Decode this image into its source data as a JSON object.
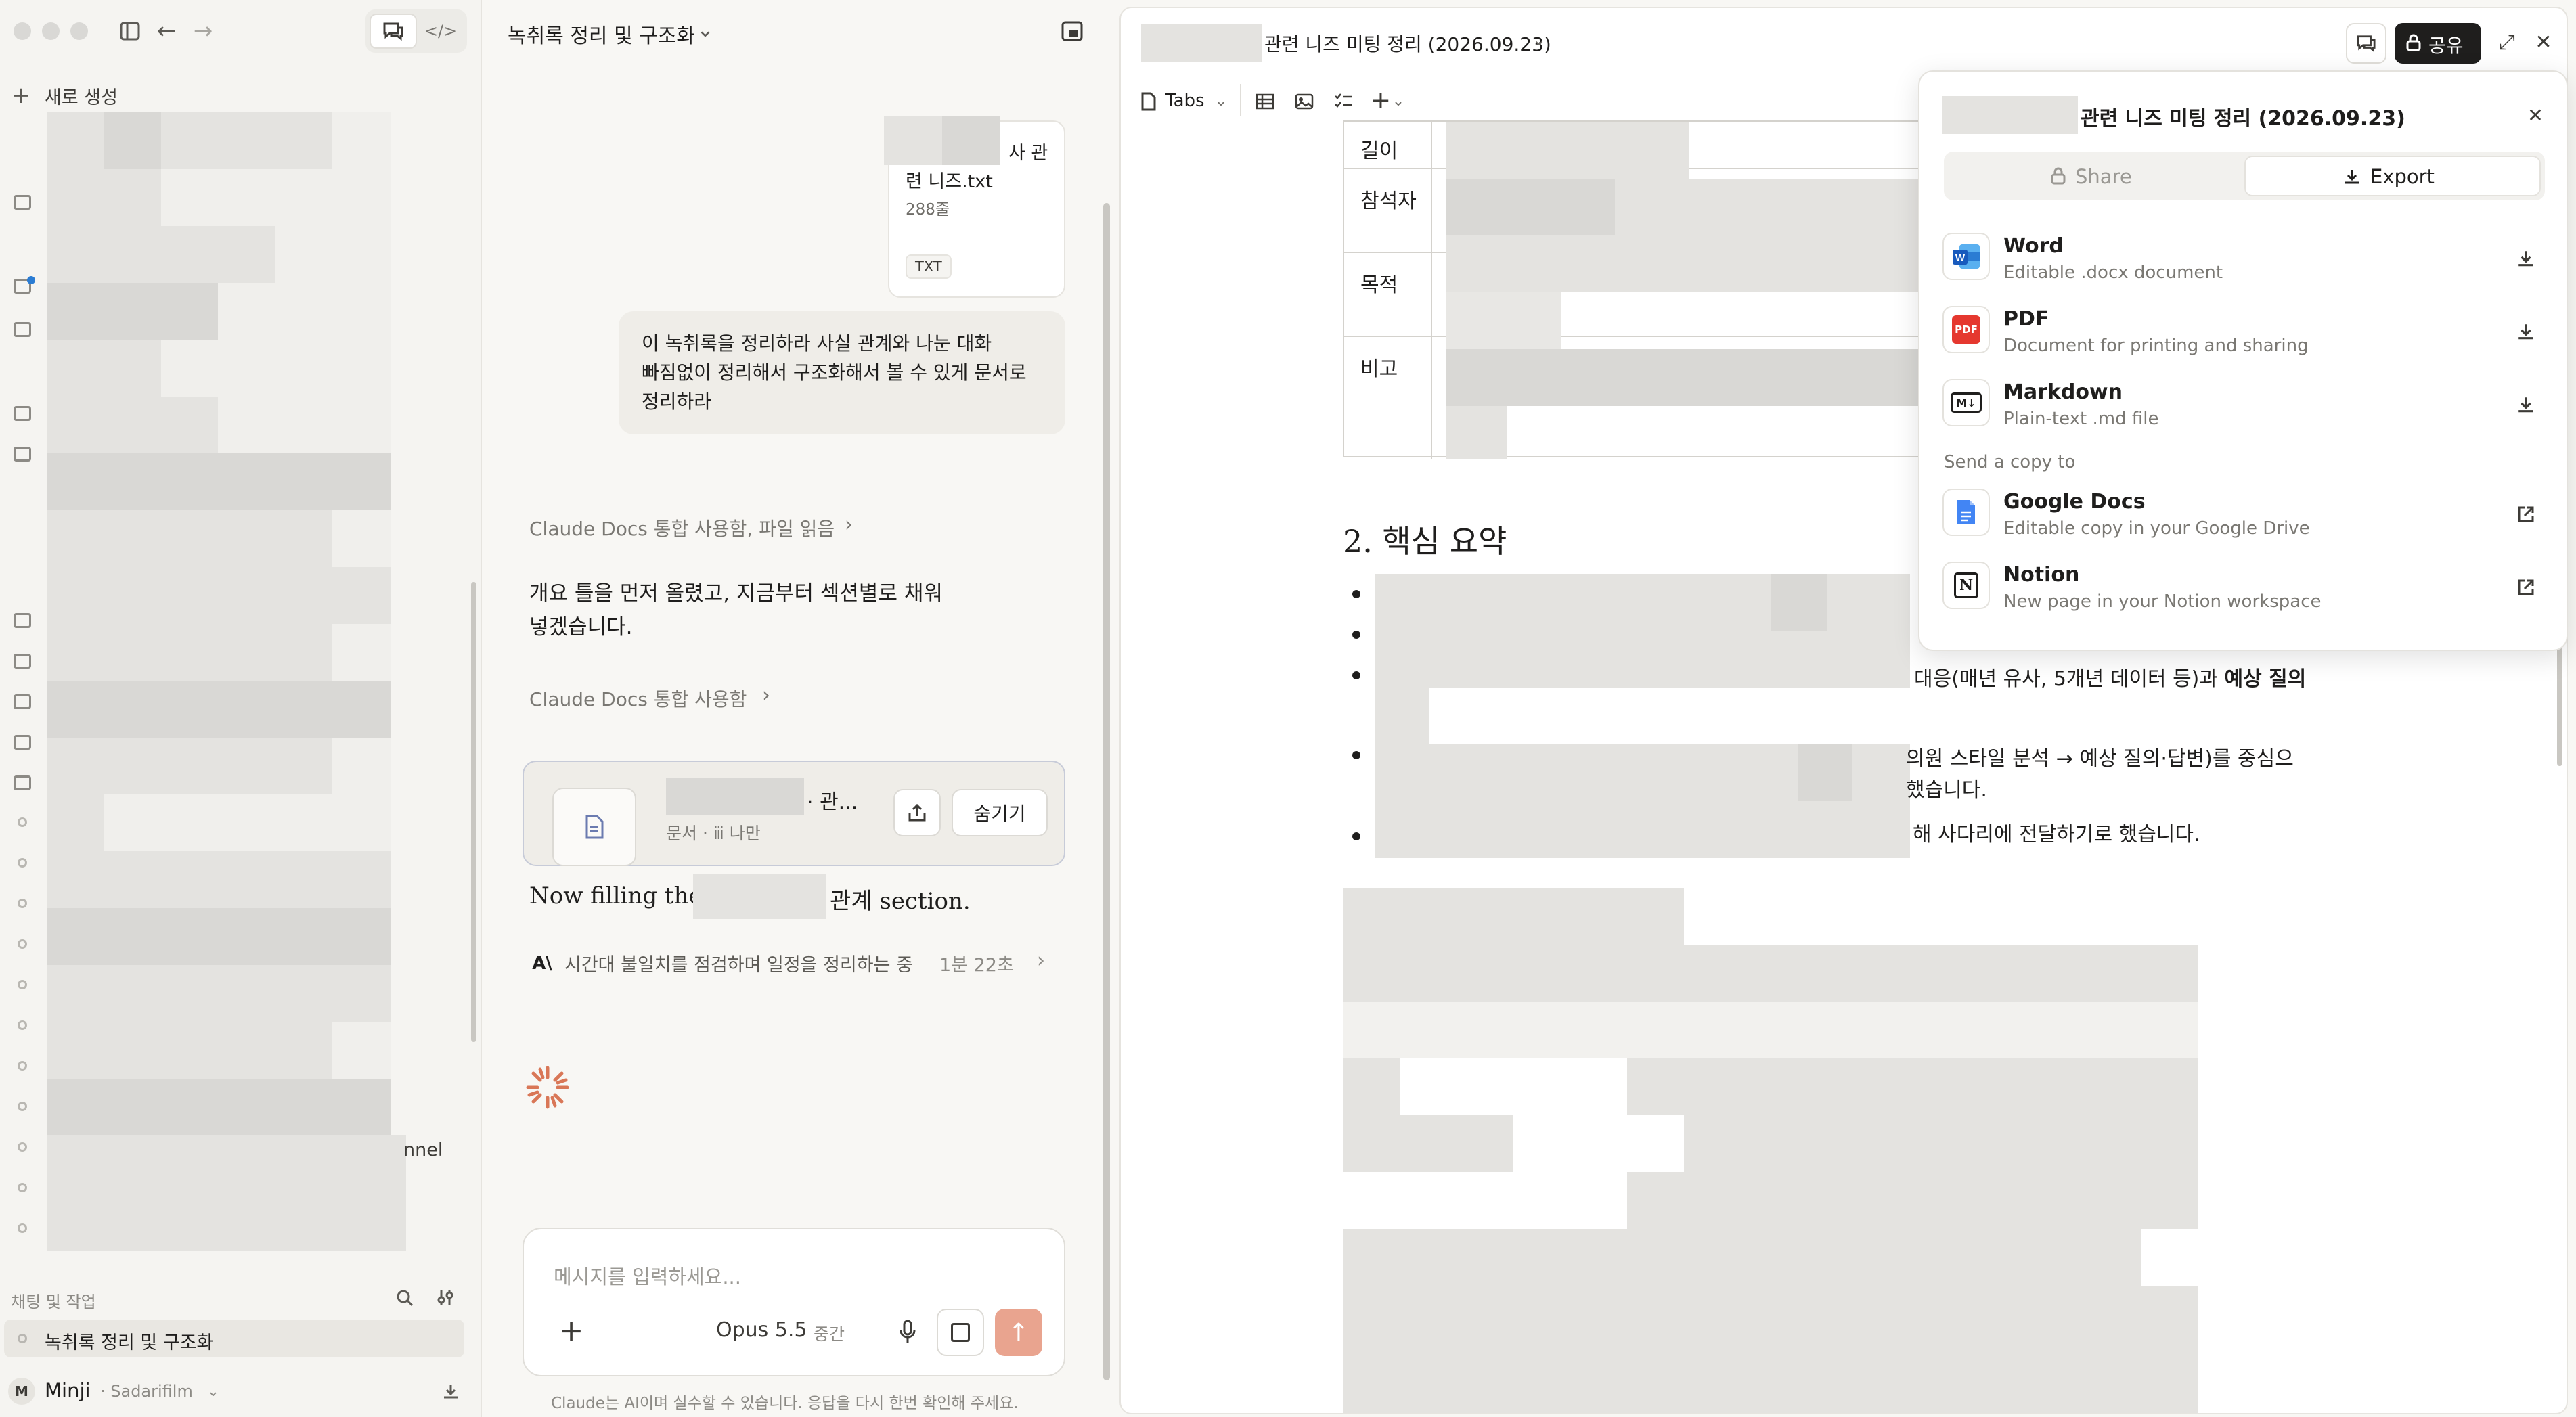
{
  "sidebar": {
    "new_label": "새로 생성",
    "partial_item_text": "nnel",
    "section_label": "채팅 및 작업",
    "active_chat": "녹취록 정리 및 구조화",
    "user_initial": "M",
    "user_name": "Minji",
    "user_org": "· Sadarifilm"
  },
  "chat": {
    "title": "녹취록 정리 및 구조화",
    "attachment": {
      "name_tail": "사 관",
      "name_line2": "련 니즈.txt",
      "lines": "288줄",
      "type": "TXT"
    },
    "user_message": "이 녹취록을 정리하라 사실 관계와 나눈 대화 빠짐없이 정리해서 구조화해서 볼 수 있게 문서로 정리하라",
    "tool1": "Claude Docs 통합 사용함, 파일 읽음",
    "assistant_msg": "개요 틀을 먼저 올렸고, 지금부터 섹션별로 채워 넣겠습니다.",
    "tool2": "Claude Docs 통합 사용함",
    "doc_card": {
      "title_tail": "· 관...",
      "meta": "문서 · ⅲ 나만",
      "hide_label": "숨기기"
    },
    "filling_prefix": "Now filling the",
    "filling_suffix": "관계 section.",
    "thinking": "시간대 불일치를 점검하며 일정을 정리하는 중",
    "elapsed": "1분 22초",
    "input_placeholder": "메시지를 입력하세요...",
    "model": "Opus 5.5",
    "effort": "중간",
    "disclaimer": "Claude는 AI이며 실수할 수 있습니다. 응답을 다시 한번 확인해 주세요."
  },
  "doc": {
    "title": "관련 니즈 미팅 정리 (2026.09.23)",
    "share_label": "공유",
    "tabs_label": "Tabs",
    "table_rows": [
      "길이",
      "참석자",
      "목적",
      "비고"
    ],
    "section_heading": "2. 핵심 요약",
    "bullet3_text": "대응(매년 유사, 5개년 데이터 등)과",
    "bullet3_bold": "예상 질의",
    "bullet4_line1": "의원 스타일 분석 → 예상 질의·답변)를 중심으",
    "bullet4_line2": "했습니다.",
    "bullet5_text": "해 사다리에 전달하기로 했습니다."
  },
  "popup": {
    "title": "관련 니즈 미팅 정리 (2026.09.23)",
    "tab_share": "Share",
    "tab_export": "Export",
    "items": [
      {
        "name": "Word",
        "desc": "Editable .docx document"
      },
      {
        "name": "PDF",
        "desc": "Document for printing and sharing"
      },
      {
        "name": "Markdown",
        "desc": "Plain-text .md file"
      }
    ],
    "copy_label": "Send a copy to",
    "copies": [
      {
        "name": "Google Docs",
        "desc": "Editable copy in your Google Drive"
      },
      {
        "name": "Notion",
        "desc": "New page in your Notion workspace"
      }
    ]
  },
  "colors": {
    "accent": "#d97757",
    "pdf_red": "#e5382f",
    "word_blue": "#2b7cd3",
    "gdocs_blue": "#4285f4"
  }
}
